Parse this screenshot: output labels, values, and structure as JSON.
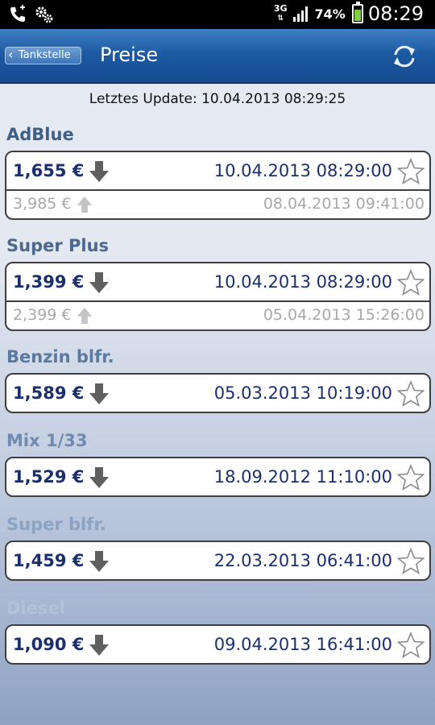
{
  "status_bar": {
    "network": "3G",
    "battery_percent": "74%",
    "time": "08:29"
  },
  "header": {
    "back_label": "Tankstelle",
    "title": "Preise",
    "refresh_icon": "refresh-icon"
  },
  "last_update": "Letztes Update: 10.04.2013 08:29:25",
  "colors": {
    "header_blue": "#1d5aa3",
    "price_text": "#1b2f6e",
    "muted_text": "#a8a8a8"
  },
  "fuels": [
    {
      "name": "AdBlue",
      "title_color": "#3e5f86",
      "current": {
        "price": "1,655 €",
        "trend": "down",
        "date": "10.04.2013 08:29:00"
      },
      "previous": {
        "price": "3,985 €",
        "trend": "up",
        "date": "08.04.2013 09:41:00"
      }
    },
    {
      "name": "Super Plus",
      "title_color": "#4a6890",
      "current": {
        "price": "1,399 €",
        "trend": "down",
        "date": "10.04.2013 08:29:00"
      },
      "previous": {
        "price": "2,399 €",
        "trend": "up",
        "date": "05.04.2013 15:26:00"
      }
    },
    {
      "name": "Benzin blfr.",
      "title_color": "#5a7aa0",
      "current": {
        "price": "1,589 €",
        "trend": "down",
        "date": "05.03.2013 10:19:00"
      }
    },
    {
      "name": "Mix 1/33",
      "title_color": "#6f8cb0",
      "current": {
        "price": "1,529 €",
        "trend": "down",
        "date": "18.09.2012 11:10:00"
      }
    },
    {
      "name": "Super blfr.",
      "title_color": "#8ca3c3",
      "current": {
        "price": "1,459 €",
        "trend": "down",
        "date": "22.03.2013 06:41:00"
      }
    },
    {
      "name": "Diesel",
      "title_color": "#b3c2d9",
      "current": {
        "price": "1,090 €",
        "trend": "down",
        "date": "09.04.2013 16:41:00"
      }
    }
  ]
}
